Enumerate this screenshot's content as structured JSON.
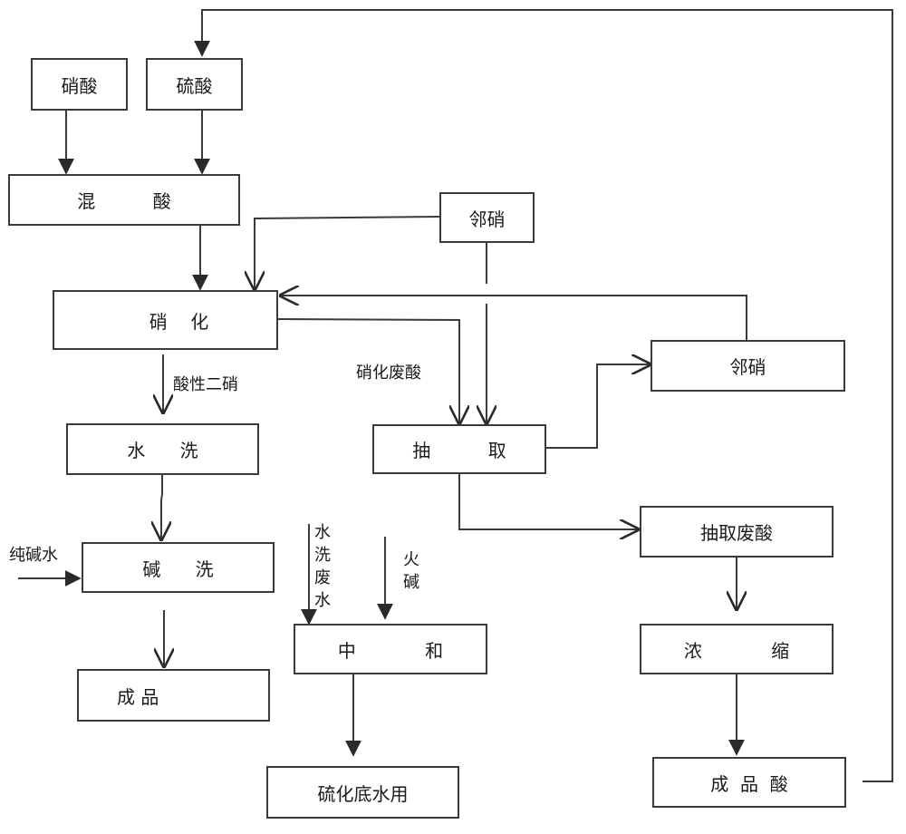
{
  "diagram": {
    "colors": {
      "line": "#3a3a3a",
      "text": "#1a1a1a",
      "background": "#ffffff"
    },
    "boxes": {
      "nitric_acid": "硝酸",
      "sulfuric_acid": "硫酸",
      "mixed_acid": "混          酸",
      "ortho_nitro_feed": "邻硝",
      "nitration": "硝    化",
      "ortho_nitro_product": "邻硝",
      "water_wash": "水      洗",
      "extraction": "抽          取",
      "alkali_wash": "碱      洗",
      "extraction_waste_acid": "抽取废酸",
      "neutralization": "中            和",
      "concentration": "浓            缩",
      "finished_product": "成 品",
      "sulfide_bottom_water": "硫化底水用",
      "finished_acid": "成  品  酸"
    },
    "labels": {
      "acidic_dinitro": "酸性二硝",
      "nitration_waste_acid": "硝化废酸",
      "soda_ash_water": "纯碱水",
      "wash_waste_water": "水洗废水",
      "caustic_soda": "火碱"
    },
    "edges": [
      {
        "from": "硝酸",
        "to": "混酸"
      },
      {
        "from": "硫酸",
        "to": "混酸"
      },
      {
        "from": "混酸",
        "to": "硝化"
      },
      {
        "from": "邻硝",
        "to": "硝化"
      },
      {
        "from": "邻硝",
        "to": "抽取"
      },
      {
        "from": "硝化",
        "to": "水洗",
        "label": "酸性二硝"
      },
      {
        "from": "硝化",
        "to": "抽取",
        "label": "硝化废酸"
      },
      {
        "from": "抽取",
        "to": "邻硝(产品)"
      },
      {
        "from": "邻硝(产品)",
        "to": "硝化"
      },
      {
        "from": "抽取",
        "to": "抽取废酸"
      },
      {
        "from": "水洗",
        "to": "碱洗"
      },
      {
        "from": "纯碱水",
        "to": "碱洗"
      },
      {
        "from": "碱洗",
        "to": "成品"
      },
      {
        "from": "水洗废水",
        "to": "中和"
      },
      {
        "from": "火碱",
        "to": "中和"
      },
      {
        "from": "中和",
        "to": "硫化底水用"
      },
      {
        "from": "抽取废酸",
        "to": "浓缩"
      },
      {
        "from": "浓缩",
        "to": "成品酸"
      },
      {
        "from": "成品酸",
        "to": "硫酸"
      }
    ]
  }
}
